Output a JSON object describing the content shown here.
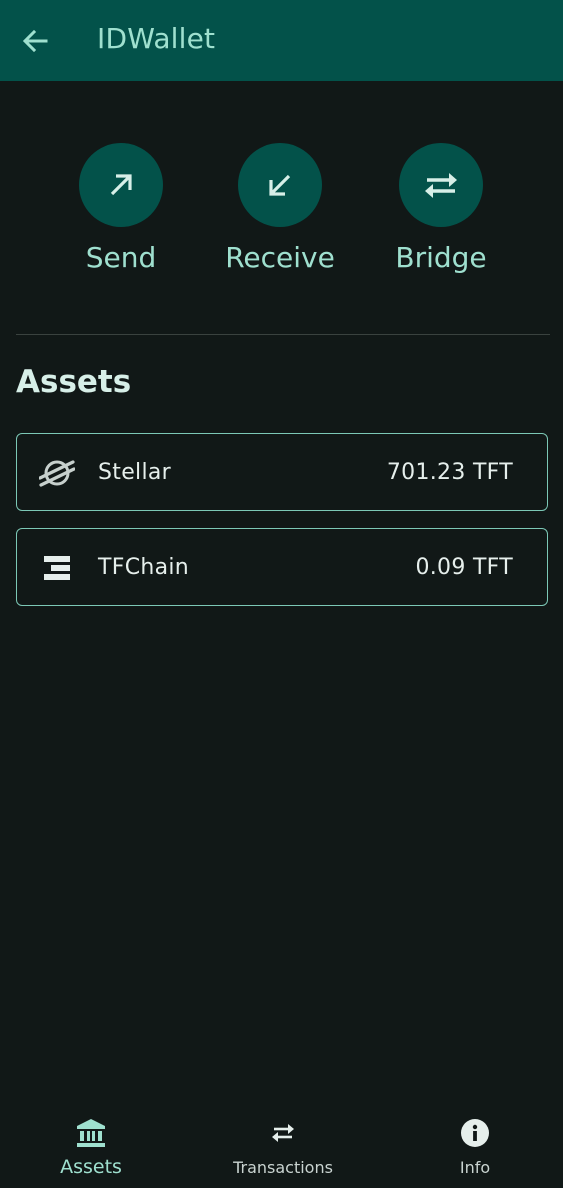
{
  "app_bar": {
    "title": "IDWallet",
    "back_icon": "arrow-left-icon"
  },
  "actions": [
    {
      "label": "Send",
      "icon": "arrow-up-right-icon"
    },
    {
      "label": "Receive",
      "icon": "arrow-down-left-icon"
    },
    {
      "label": "Bridge",
      "icon": "swap-arrows-icon"
    }
  ],
  "assets_section": {
    "title": "Assets",
    "items": [
      {
        "name": "Stellar",
        "balance": "701.23 TFT",
        "icon": "stellar-logo-icon"
      },
      {
        "name": "TFChain",
        "balance": "0.09 TFT",
        "icon": "tfchain-logo-icon"
      }
    ]
  },
  "bottom_nav": {
    "items": [
      {
        "label": "Assets",
        "icon": "bank-icon",
        "active": true
      },
      {
        "label": "Transactions",
        "icon": "swap-arrows-icon",
        "active": false
      },
      {
        "label": "Info",
        "icon": "info-icon",
        "active": false
      }
    ]
  },
  "colors": {
    "background": "#111817",
    "app_bar": "#03524a",
    "accent": "#9fe0cf",
    "card_border": "#7cc8b6",
    "text": "#e6efec",
    "inactive_nav": "#c9d3d0"
  }
}
